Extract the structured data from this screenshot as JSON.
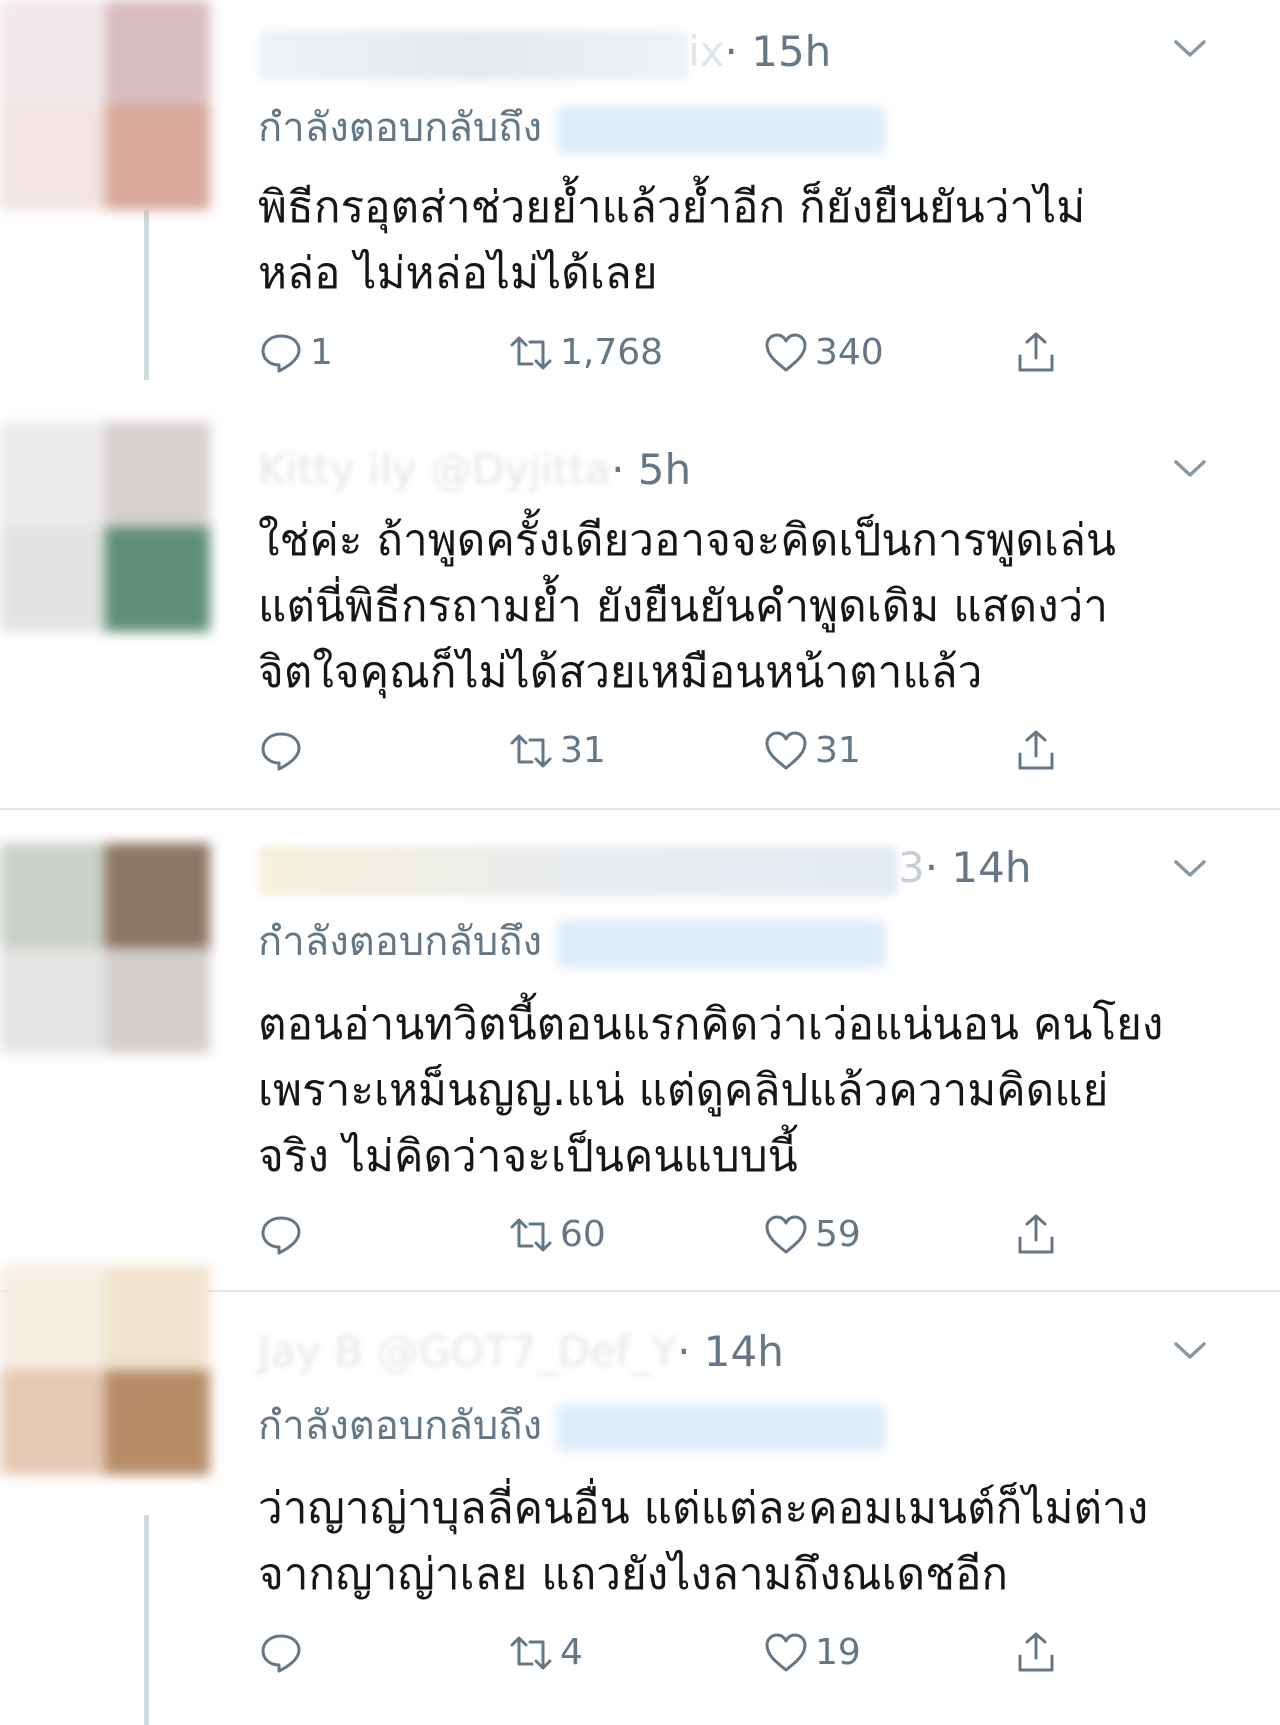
{
  "tweets": [
    {
      "name_tail": "ix",
      "time": "· 15h",
      "reply_label": "กำลังตอบกลับถึง",
      "body_lines": [
        "พิธีกรอุตส่าช่วยย้ำแล้วย้ำอีก ก็ยังยืนยันว่าไม่",
        "หล่อ ไม่หล่อไม่ได้เลย"
      ],
      "reply_count": "1",
      "retweet_count": "1,768",
      "like_count": "340",
      "avatar_colors": [
        "#f3e9ea",
        "#d9bcc2",
        "#f2e4e2",
        "#d8a899"
      ]
    },
    {
      "name_tail": "Kitty ily @Dyjitta",
      "time": "· 5h",
      "reply_label": "",
      "body_lines": [
        "ใช่ค่ะ ถ้าพูดครั้งเดียวอาจจะคิดเป็นการพูดเล่น",
        "แต่นี่พิธีกรถามย้ำ ยังยืนยันคำพูดเดิม แสดงว่า",
        "จิตใจคุณก็ไม่ได้สวยเหมือนหน้าตาแล้ว"
      ],
      "reply_count": "",
      "retweet_count": "31",
      "like_count": "31",
      "avatar_colors": [
        "#ecebeb",
        "#d6d0cf",
        "#e2e2e2",
        "#5f8f78"
      ]
    },
    {
      "name_tail": "3",
      "time": "· 14h",
      "reply_label": "กำลังตอบกลับถึง",
      "body_lines": [
        "ตอนอ่านทวิตนี้ตอนแรกคิดว่าเว่อแน่นอน คนโยง",
        "เพราะเหม็นญญ.แน่ แต่ดูคลิปแล้วความคิดแย่",
        "จริง ไม่คิดว่าจะเป็นคนแบบนี้"
      ],
      "reply_count": "",
      "retweet_count": "60",
      "like_count": "59",
      "avatar_colors": [
        "#c9d1c8",
        "#8e7463",
        "#e5e4e3",
        "#d3cfcd"
      ]
    },
    {
      "name_tail": "Jay B @GOT7_Def_Y",
      "time": "· 14h",
      "reply_label": "กำลังตอบกลับถึง",
      "body_lines": [
        "ว่าญาญ่าบุลลี่คนอื่น แต่แต่ละคอมเมนต์ก็ไม่ต่าง",
        "จากญาญ่าเลย แถวยังไงลามถึงณเดชอีก"
      ],
      "reply_count": "",
      "retweet_count": "4",
      "like_count": "19",
      "avatar_colors": [
        "#f6ede3",
        "#f1e3cf",
        "#e6c8b4",
        "#b68c69"
      ]
    }
  ],
  "icons": {
    "reply": "reply-bubble-icon",
    "retweet": "retweet-icon",
    "like": "heart-icon",
    "share": "share-icon",
    "more": "chevron-down-icon"
  },
  "colors": {
    "secondary_text": "#657786",
    "primary_text": "#14171a",
    "divider": "#e1e8ed"
  }
}
